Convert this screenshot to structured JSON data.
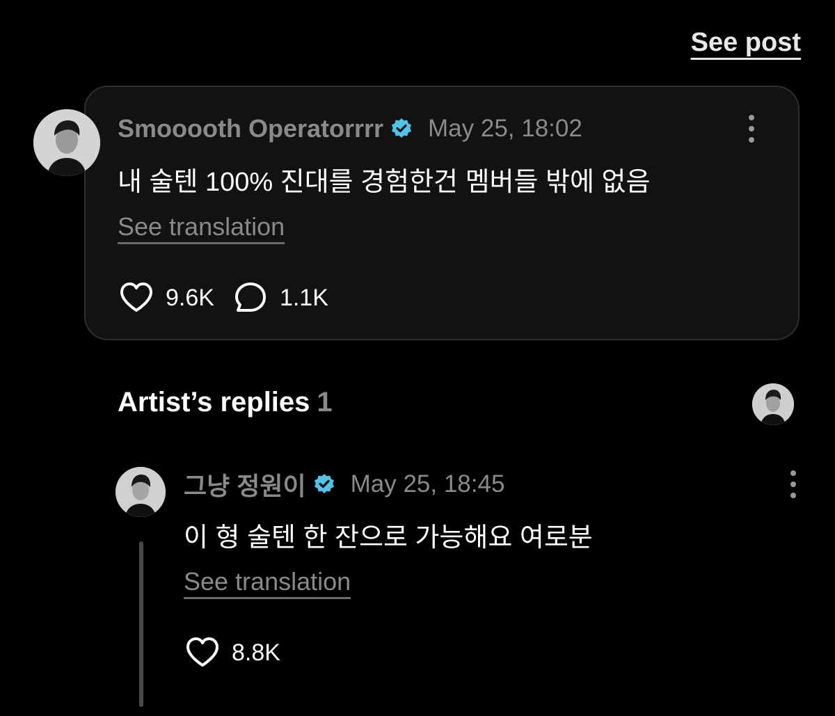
{
  "header": {
    "see_post_label": "See post"
  },
  "post": {
    "author": "Smooooth Operatorrrr",
    "verified_icon": "verified-badge-icon",
    "timestamp": "May 25, 18:02",
    "body": "내 술텐 100% 진대를 경험한건 멤버들 밖에 없음",
    "translate_label": "See translation",
    "likes": "9.6K",
    "comments": "1.1K"
  },
  "artist_replies": {
    "title": "Artist’s replies",
    "count": "1"
  },
  "reply": {
    "author": "그냥 정원이",
    "verified_icon": "verified-badge-icon",
    "timestamp": "May 25, 18:45",
    "body": "이 형 술텐 한 잔으로 가능해요 여로분",
    "translate_label": "See translation",
    "likes": "8.8K"
  },
  "colors": {
    "background": "#000000",
    "card": "#121212",
    "muted_text": "#8a8a8a",
    "verified": "#4fc3e8"
  }
}
